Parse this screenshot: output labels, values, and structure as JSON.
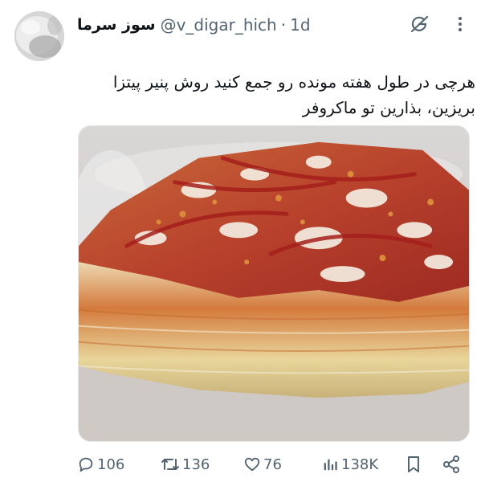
{
  "post": {
    "author_name": "سوز سرما",
    "handle": "@v_digar_hich",
    "separator": "·",
    "time": "1d",
    "text_lines": [
      "هرچی در طول هفته مونده رو جمع کنید روش پنیر پیتزا",
      "بریزین، بذارین تو ماکروفر"
    ]
  },
  "icons": {
    "grok": "grok-icon",
    "more": "more-icon",
    "reply": "reply-icon",
    "repost": "repost-icon",
    "like": "heart-icon",
    "views": "views-icon",
    "bookmark": "bookmark-icon",
    "share": "share-icon"
  },
  "actions": {
    "replies": "106",
    "reposts": "136",
    "likes": "76",
    "views": "138K"
  },
  "colors": {
    "text": "#0f1419",
    "secondary": "#536471"
  }
}
